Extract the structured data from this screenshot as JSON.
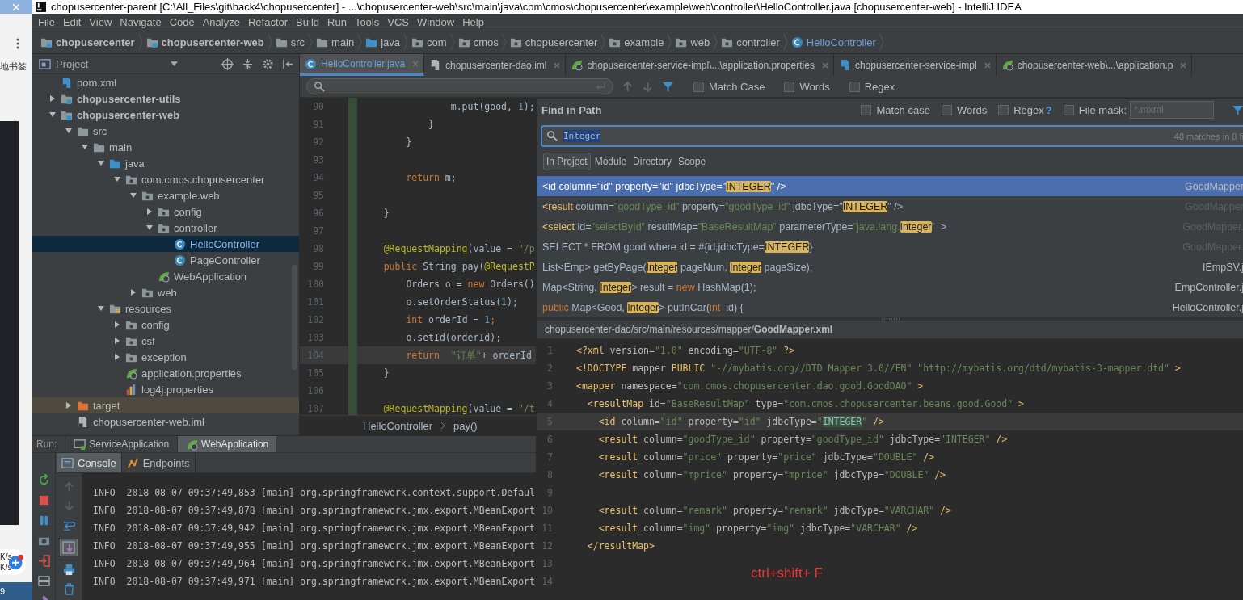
{
  "background_window": {
    "bookmark_text": "地书签",
    "speeds": [
      "K/s",
      "K/s"
    ],
    "taskbar_text": "9"
  },
  "window": {
    "title": "chopusercenter-parent [C:\\All_Files\\git\\back4\\chopusercenter] - ...\\chopusercenter-web\\src\\main\\java\\com\\cmos\\chopusercenter\\example\\web\\controller\\HelloController.java [chopusercenter-web] - IntelliJ IDEA"
  },
  "menu": [
    "File",
    "Edit",
    "View",
    "Navigate",
    "Code",
    "Analyze",
    "Refactor",
    "Build",
    "Run",
    "Tools",
    "VCS",
    "Window",
    "Help"
  ],
  "breadcrumbs": [
    {
      "label": "chopusercenter",
      "kind": "module"
    },
    {
      "label": "chopusercenter-web",
      "kind": "module"
    },
    {
      "label": "src",
      "kind": "folder"
    },
    {
      "label": "main",
      "kind": "folder"
    },
    {
      "label": "java",
      "kind": "source"
    },
    {
      "label": "com",
      "kind": "package"
    },
    {
      "label": "cmos",
      "kind": "package"
    },
    {
      "label": "chopusercenter",
      "kind": "package"
    },
    {
      "label": "example",
      "kind": "package"
    },
    {
      "label": "web",
      "kind": "package"
    },
    {
      "label": "controller",
      "kind": "package"
    },
    {
      "label": "HelloController",
      "kind": "class"
    }
  ],
  "project": {
    "title": "Project",
    "tree": [
      {
        "label": "pom.xml",
        "kind": "maven",
        "selected": false
      },
      {
        "label": "chopusercenter-utils",
        "kind": "module",
        "expanded": false,
        "selected": false
      },
      {
        "label": "chopusercenter-web",
        "kind": "module",
        "expanded": true,
        "selected": false,
        "children": [
          {
            "label": "src",
            "kind": "folder",
            "expanded": true,
            "selected": false,
            "children": [
              {
                "label": "main",
                "kind": "folder",
                "expanded": true,
                "selected": false,
                "children": [
                  {
                    "label": "java",
                    "kind": "source",
                    "expanded": true,
                    "selected": false,
                    "children": [
                      {
                        "label": "com.cmos.chopusercenter",
                        "kind": "package",
                        "expanded": true,
                        "selected": false,
                        "children": [
                          {
                            "label": "example.web",
                            "kind": "package",
                            "expanded": true,
                            "selected": false,
                            "children": [
                              {
                                "label": "config",
                                "kind": "package",
                                "expanded": false,
                                "selected": false
                              },
                              {
                                "label": "controller",
                                "kind": "package",
                                "expanded": true,
                                "selected": false,
                                "children": [
                                  {
                                    "label": "HelloController",
                                    "kind": "class",
                                    "selected": true
                                  },
                                  {
                                    "label": "PageController",
                                    "kind": "class",
                                    "selected": false
                                  }
                                ]
                              },
                              {
                                "label": "WebApplication",
                                "kind": "spring",
                                "selected": false
                              }
                            ]
                          },
                          {
                            "label": "web",
                            "kind": "package",
                            "expanded": false,
                            "selected": false
                          }
                        ]
                      }
                    ]
                  },
                  {
                    "label": "resources",
                    "kind": "resources",
                    "expanded": true,
                    "selected": false,
                    "children": [
                      {
                        "label": "config",
                        "kind": "package",
                        "expanded": false,
                        "selected": false
                      },
                      {
                        "label": "csf",
                        "kind": "package",
                        "expanded": false,
                        "selected": false
                      },
                      {
                        "label": "exception",
                        "kind": "package",
                        "expanded": false,
                        "selected": false
                      },
                      {
                        "label": "application.properties",
                        "kind": "spring",
                        "selected": false
                      },
                      {
                        "label": "log4j.properties",
                        "kind": "log",
                        "selected": false
                      }
                    ]
                  }
                ]
              }
            ]
          },
          {
            "label": "target",
            "kind": "excluded",
            "expanded": false,
            "selected": false
          },
          {
            "label": "chopusercenter-web.iml",
            "kind": "file",
            "selected": false
          }
        ]
      }
    ]
  },
  "editor": {
    "tabs": [
      {
        "label": "HelloController.java",
        "kind": "class",
        "selected": true
      },
      {
        "label": "chopusercenter-dao.iml",
        "kind": "file",
        "selected": false
      },
      {
        "label": "chopusercenter-service-impl\\...\\application.properties",
        "kind": "spring",
        "selected": false
      },
      {
        "label": "chopusercenter-service-impl",
        "kind": "maven",
        "selected": false
      },
      {
        "label": "chopusercenter-web\\...\\application.p",
        "kind": "spring",
        "selected": false
      }
    ],
    "search_options": [
      {
        "label": "Match Case",
        "checked": false
      },
      {
        "label": "Words",
        "checked": false
      },
      {
        "label": "Regex",
        "checked": false
      }
    ],
    "lines": [
      {
        "n": "90",
        "current": false,
        "tokens": [
          {
            "t": "                m.put(good, ",
            "kind": "plain"
          },
          {
            "t": "1",
            "kind": "number"
          },
          {
            "t": ");",
            "kind": "plain"
          }
        ]
      },
      {
        "n": "91",
        "current": false,
        "tokens": [
          {
            "t": "            }",
            "kind": "plain"
          }
        ]
      },
      {
        "n": "92",
        "current": false,
        "tokens": [
          {
            "t": "        }",
            "kind": "plain"
          }
        ]
      },
      {
        "n": "93",
        "current": false
      },
      {
        "n": "94",
        "current": false,
        "tokens": [
          {
            "t": "        return",
            "kind": "keyword"
          },
          {
            "t": " m;",
            "kind": "plain"
          }
        ]
      },
      {
        "n": "95",
        "current": false
      },
      {
        "n": "96",
        "current": false,
        "tokens": [
          {
            "t": "    }",
            "kind": "plain"
          }
        ]
      },
      {
        "n": "97",
        "current": false
      },
      {
        "n": "98",
        "current": false,
        "tokens": [
          {
            "t": "    @RequestMapping",
            "kind": "annotation"
          },
          {
            "t": "(value = ",
            "kind": "plain"
          },
          {
            "t": "\"/p",
            "kind": "string"
          }
        ]
      },
      {
        "n": "99",
        "current": false,
        "tokens": [
          {
            "t": "    public",
            "kind": "keyword"
          },
          {
            "t": " String pay(",
            "kind": "plain"
          },
          {
            "t": "@RequestP",
            "kind": "annotation"
          }
        ]
      },
      {
        "n": "100",
        "current": false,
        "tokens": [
          {
            "t": "        Orders o = ",
            "kind": "plain"
          },
          {
            "t": "new",
            "kind": "keyword"
          },
          {
            "t": " Orders()",
            "kind": "plain"
          }
        ]
      },
      {
        "n": "101",
        "current": false,
        "tokens": [
          {
            "t": "        o.setOrderStatus(",
            "kind": "plain"
          },
          {
            "t": "1",
            "kind": "number"
          },
          {
            "t": ");",
            "kind": "plain"
          }
        ]
      },
      {
        "n": "102",
        "current": false,
        "tokens": [
          {
            "t": "        int",
            "kind": "keyword"
          },
          {
            "t": " orderId = ",
            "kind": "plain"
          },
          {
            "t": "1",
            "kind": "number"
          },
          {
            "t": ";",
            "kind": "keyword"
          }
        ]
      },
      {
        "n": "103",
        "current": false,
        "tokens": [
          {
            "t": "        o.setId(orderId);",
            "kind": "plain"
          }
        ]
      },
      {
        "n": "104",
        "current": true,
        "tokens": [
          {
            "t": "        return",
            "kind": "keyword"
          },
          {
            "t": "  \"订单\"",
            "kind": "string"
          },
          {
            "t": "+ orderId",
            "kind": "plain"
          }
        ]
      },
      {
        "n": "105",
        "current": false,
        "tokens": [
          {
            "t": "    }",
            "kind": "plain"
          }
        ]
      },
      {
        "n": "106",
        "current": false
      },
      {
        "n": "107",
        "current": false,
        "tokens": [
          {
            "t": "    @RequestMapping",
            "kind": "annotation"
          },
          {
            "t": "(value = ",
            "kind": "plain"
          },
          {
            "t": "\"/t",
            "kind": "string"
          }
        ]
      }
    ],
    "breadcrumb": [
      "HelloController",
      "pay()"
    ]
  },
  "find_in_path": {
    "title": "Find in Path",
    "options": [
      {
        "label": "Match case",
        "checked": false
      },
      {
        "label": "Words",
        "checked": false
      },
      {
        "label": "Regex",
        "checked": false,
        "help": "?"
      },
      {
        "label": "File mask:",
        "checked": false
      }
    ],
    "file_mask": {
      "placeholder": "*.mxml"
    },
    "query": "Integer",
    "match_count": "48 matches in 8 fi",
    "scopes": [
      {
        "label": "In Project",
        "selected": true
      },
      {
        "label": "Module",
        "selected": false
      },
      {
        "label": "Directory",
        "selected": false
      },
      {
        "label": "Scope",
        "selected": false
      }
    ],
    "results": [
      {
        "selected": true,
        "file": "GoodMapper",
        "dimmed": false,
        "tokens": [
          {
            "t": "<id",
            "kind": "tag"
          },
          {
            "t": " column=",
            "kind": "plain"
          },
          {
            "t": "\"id\"",
            "kind": "string"
          },
          {
            "t": " property=",
            "kind": "plain"
          },
          {
            "t": "\"id\"",
            "kind": "string"
          },
          {
            "t": " jdbcType=\"",
            "kind": "plain"
          },
          {
            "t": "INTEGER",
            "kind": "match"
          },
          {
            "t": "\" />",
            "kind": "plain"
          }
        ]
      },
      {
        "selected": false,
        "file": "GoodMapper",
        "dimmed": true,
        "tokens": [
          {
            "t": "<result",
            "kind": "tag"
          },
          {
            "t": " column=",
            "kind": "plain"
          },
          {
            "t": "\"goodType_id\"",
            "kind": "string"
          },
          {
            "t": " property=",
            "kind": "plain"
          },
          {
            "t": "\"goodType_id\"",
            "kind": "string"
          },
          {
            "t": " jdbcType=\"",
            "kind": "plain"
          },
          {
            "t": "INTEGER",
            "kind": "match"
          },
          {
            "t": "\" />",
            "kind": "plain"
          }
        ]
      },
      {
        "selected": false,
        "file": "GoodMapper.",
        "dimmed": true,
        "tokens": [
          {
            "t": "<select",
            "kind": "tag"
          },
          {
            "t": " id=",
            "kind": "plain"
          },
          {
            "t": "\"selectById\"",
            "kind": "string"
          },
          {
            "t": " resultMap=",
            "kind": "plain"
          },
          {
            "t": "\"BaseResultMap\"",
            "kind": "string"
          },
          {
            "t": " parameterType=",
            "kind": "plain"
          },
          {
            "t": "\"java.lang.",
            "kind": "string"
          },
          {
            "t": "Integer",
            "kind": "match"
          },
          {
            "t": "\"",
            "kind": "string"
          },
          {
            "t": "  >",
            "kind": "plain"
          }
        ]
      },
      {
        "selected": false,
        "file": "GoodMapper.",
        "dimmed": true,
        "tokens": [
          {
            "t": "SELECT * FROM good where id = #{id,jdbcType=",
            "kind": "plain"
          },
          {
            "t": "INTEGER",
            "kind": "match"
          },
          {
            "t": "}",
            "kind": "plain"
          }
        ]
      },
      {
        "selected": false,
        "file": "IEmpSV.j",
        "dimmed": false,
        "tokens": [
          {
            "t": "List<Emp> getByPage(",
            "kind": "plain"
          },
          {
            "t": "Integer",
            "kind": "match"
          },
          {
            "t": " pageNum, ",
            "kind": "plain"
          },
          {
            "t": "Integer",
            "kind": "match"
          },
          {
            "t": " pageSize);",
            "kind": "plain"
          }
        ]
      },
      {
        "selected": false,
        "file": "EmpController.j",
        "dimmed": false,
        "tokens": [
          {
            "t": "Map<String, ",
            "kind": "plain"
          },
          {
            "t": "Integer",
            "kind": "match"
          },
          {
            "t": "> result = ",
            "kind": "plain"
          },
          {
            "t": "new",
            "kind": "keyword"
          },
          {
            "t": " HashMap(1);",
            "kind": "plain"
          }
        ]
      },
      {
        "selected": false,
        "file": "HelloController.j",
        "dimmed": false,
        "tokens": [
          {
            "t": "public",
            "kind": "keyword"
          },
          {
            "t": " Map<Good, ",
            "kind": "plain"
          },
          {
            "t": "Integer",
            "kind": "match"
          },
          {
            "t": "> putInCar(",
            "kind": "plain"
          },
          {
            "t": "int",
            "kind": "keyword"
          },
          {
            "t": "  id) {",
            "kind": "plain"
          }
        ]
      }
    ],
    "preview_path": "chopusercenter-dao/src/main/resources/mapper/**GoodMapper.xml**",
    "preview_lines": [
      {
        "n": "1",
        "current": false,
        "tokens": [
          {
            "t": "<?xml",
            "kind": "tag"
          },
          {
            "t": " version=",
            "kind": "attr"
          },
          {
            "t": "\"1.0\"",
            "kind": "string"
          },
          {
            "t": " encoding=",
            "kind": "attr"
          },
          {
            "t": "\"UTF-8\"",
            "kind": "string"
          },
          {
            "t": " ?>",
            "kind": "tag"
          }
        ]
      },
      {
        "n": "2",
        "current": false,
        "tokens": [
          {
            "t": "<!DOCTYPE",
            "kind": "tag"
          },
          {
            "t": " mapper ",
            "kind": "attr"
          },
          {
            "t": "PUBLIC",
            "kind": "tag"
          },
          {
            "t": " \"-//mybatis.org//DTD Mapper 3.0//EN\"",
            "kind": "string"
          },
          {
            "t": " \"http://mybatis.org/dtd/mybatis-3-mapper.dtd\"",
            "kind": "string"
          },
          {
            "t": " >",
            "kind": "tag"
          }
        ]
      },
      {
        "n": "3",
        "current": false,
        "tokens": [
          {
            "t": "<mapper",
            "kind": "tag"
          },
          {
            "t": " namespace=",
            "kind": "attr"
          },
          {
            "t": "\"com.cmos.chopusercenter.dao.good.GoodDAO\"",
            "kind": "string"
          },
          {
            "t": " >",
            "kind": "tag"
          }
        ]
      },
      {
        "n": "4",
        "current": false,
        "tokens": [
          {
            "t": "  <resultMap",
            "kind": "tag"
          },
          {
            "t": " id=",
            "kind": "attr"
          },
          {
            "t": "\"BaseResultMap\"",
            "kind": "string"
          },
          {
            "t": " type=",
            "kind": "attr"
          },
          {
            "t": "\"com.cmos.chopusercenter.beans.good.Good\"",
            "kind": "string"
          },
          {
            "t": " >",
            "kind": "tag"
          }
        ]
      },
      {
        "n": "5",
        "current": true,
        "tokens": [
          {
            "t": "    <id",
            "kind": "tag"
          },
          {
            "t": " column=",
            "kind": "attr"
          },
          {
            "t": "\"id\"",
            "kind": "string"
          },
          {
            "t": " property=",
            "kind": "attr"
          },
          {
            "t": "\"id\"",
            "kind": "string"
          },
          {
            "t": " jdbcType=",
            "kind": "attr"
          },
          {
            "t": "\"",
            "kind": "string"
          },
          {
            "t": "INTEGER",
            "kind": "current"
          },
          {
            "t": "\"",
            "kind": "string"
          },
          {
            "t": " />",
            "kind": "tag"
          }
        ]
      },
      {
        "n": "6",
        "current": false,
        "tokens": [
          {
            "t": "    <result",
            "kind": "tag"
          },
          {
            "t": " column=",
            "kind": "attr"
          },
          {
            "t": "\"goodType_id\"",
            "kind": "string"
          },
          {
            "t": " property=",
            "kind": "attr"
          },
          {
            "t": "\"goodType_id\"",
            "kind": "string"
          },
          {
            "t": " jdbcType=",
            "kind": "attr"
          },
          {
            "t": "\"INTEGER\"",
            "kind": "string"
          },
          {
            "t": " />",
            "kind": "tag"
          }
        ]
      },
      {
        "n": "7",
        "current": false,
        "tokens": [
          {
            "t": "    <result",
            "kind": "tag"
          },
          {
            "t": " column=",
            "kind": "attr"
          },
          {
            "t": "\"price\"",
            "kind": "string"
          },
          {
            "t": " property=",
            "kind": "attr"
          },
          {
            "t": "\"price\"",
            "kind": "string"
          },
          {
            "t": " jdbcType=",
            "kind": "attr"
          },
          {
            "t": "\"DOUBLE\"",
            "kind": "string"
          },
          {
            "t": " />",
            "kind": "tag"
          }
        ]
      },
      {
        "n": "8",
        "current": false,
        "tokens": [
          {
            "t": "    <result",
            "kind": "tag"
          },
          {
            "t": " column=",
            "kind": "attr"
          },
          {
            "t": "\"mprice\"",
            "kind": "string"
          },
          {
            "t": " property=",
            "kind": "attr"
          },
          {
            "t": "\"mprice\"",
            "kind": "string"
          },
          {
            "t": " jdbcType=",
            "kind": "attr"
          },
          {
            "t": "\"DOUBLE\"",
            "kind": "string"
          },
          {
            "t": " />",
            "kind": "tag"
          }
        ]
      },
      {
        "n": "9",
        "current": false
      },
      {
        "n": "10",
        "current": false,
        "tokens": [
          {
            "t": "    <result",
            "kind": "tag"
          },
          {
            "t": " column=",
            "kind": "attr"
          },
          {
            "t": "\"remark\"",
            "kind": "string"
          },
          {
            "t": " property=",
            "kind": "attr"
          },
          {
            "t": "\"remark\"",
            "kind": "string"
          },
          {
            "t": " jdbcType=",
            "kind": "attr"
          },
          {
            "t": "\"VARCHAR\"",
            "kind": "string"
          },
          {
            "t": " />",
            "kind": "tag"
          }
        ]
      },
      {
        "n": "11",
        "current": false,
        "tokens": [
          {
            "t": "    <result",
            "kind": "tag"
          },
          {
            "t": " column=",
            "kind": "attr"
          },
          {
            "t": "\"img\"",
            "kind": "string"
          },
          {
            "t": " property=",
            "kind": "attr"
          },
          {
            "t": "\"img\"",
            "kind": "string"
          },
          {
            "t": " jdbcType=",
            "kind": "attr"
          },
          {
            "t": "\"VARCHAR\"",
            "kind": "string"
          },
          {
            "t": " />",
            "kind": "tag"
          }
        ]
      },
      {
        "n": "12",
        "current": false,
        "tokens": [
          {
            "t": "  </resultMap>",
            "kind": "tag"
          }
        ]
      },
      {
        "n": "13",
        "current": false
      },
      {
        "n": "14",
        "current": false
      }
    ],
    "annotation": "ctrl+shift+ F"
  },
  "run": {
    "label": "Run:",
    "tabs": [
      {
        "label": "ServiceApplication",
        "kind": "service",
        "selected": false
      },
      {
        "label": "WebApplication",
        "kind": "spring",
        "selected": true
      }
    ],
    "subtabs": [
      {
        "label": "Console",
        "kind": "console",
        "selected": true
      },
      {
        "label": "Endpoints",
        "kind": "endpoints",
        "selected": false
      }
    ],
    "scroll_to_end": true,
    "console": [
      "INFO  2018-08-07 09:37:49,853 [main] org.springframework.context.support.Defaul",
      "INFO  2018-08-07 09:37:49,878 [main] org.springframework.jmx.export.MBeanExport",
      "INFO  2018-08-07 09:37:49,942 [main] org.springframework.jmx.export.MBeanExport",
      "INFO  2018-08-07 09:37:49,955 [main] org.springframework.jmx.export.MBeanExport",
      "INFO  2018-08-07 09:37:49,964 [main] org.springframework.jmx.export.MBeanExport",
      "INFO  2018-08-07 09:37:49,971 [main] org.springframework.jmx.export.MBeanExport"
    ]
  }
}
